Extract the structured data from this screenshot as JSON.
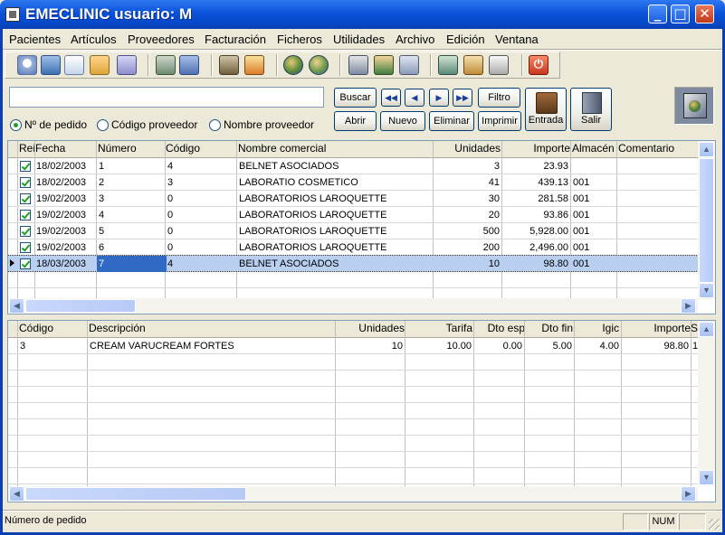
{
  "window": {
    "title": "EMECLINIC usuario: M"
  },
  "menu": [
    {
      "label": "Pacientes"
    },
    {
      "label": "Artículos"
    },
    {
      "label": "Proveedores"
    },
    {
      "label": "Facturación"
    },
    {
      "label": "Ficheros"
    },
    {
      "label": "Utilidades"
    },
    {
      "label": "Archivo"
    },
    {
      "label": "Edición"
    },
    {
      "label": "Ventana"
    }
  ],
  "toolbar": {
    "icons": [
      "calendar-icon",
      "patient-icon",
      "patient-card-icon",
      "patients-icon",
      "patient-group-icon",
      "article-icon",
      "article-card-icon",
      "books-icon",
      "house-icon",
      "globe-icon",
      "globe-list-icon",
      "computer-icon",
      "users-icon",
      "network-icon",
      "notebook-icon",
      "mail-user-icon",
      "printer-icon",
      "power-icon"
    ]
  },
  "search": {
    "value": "",
    "placeholder": ""
  },
  "buttons": {
    "buscar": "Buscar",
    "abrir": "Abrir",
    "nuevo": "Nuevo",
    "eliminar": "Eliminar",
    "imprimir": "Imprimir",
    "filtro": "Filtro",
    "entrada": "Entrada",
    "salir": "Salir"
  },
  "nav": {
    "first": "◀◀",
    "prev": "◀",
    "next": "▶",
    "last": "▶▶"
  },
  "search_mode": {
    "options": [
      "Nº de pedido",
      "Código proveedor",
      "Nombre proveedor"
    ],
    "selected": "Nº de pedido"
  },
  "orders": {
    "columns": [
      "Rei",
      "Fecha",
      "Número",
      "Código",
      "Nombre comercial",
      "Unidades",
      "Importe",
      "Almacén",
      "Comentario"
    ],
    "rows": [
      {
        "checked": true,
        "fecha": "18/02/2003",
        "numero": "1",
        "codigo": "4",
        "nombre": "BELNET ASOCIADOS",
        "unidades": "3",
        "importe": "23.93",
        "almacen": "",
        "comentario": ""
      },
      {
        "checked": true,
        "fecha": "18/02/2003",
        "numero": "2",
        "codigo": "3",
        "nombre": "LABORATIO COSMETICO",
        "unidades": "41",
        "importe": "439.13",
        "almacen": "001",
        "comentario": ""
      },
      {
        "checked": true,
        "fecha": "19/02/2003",
        "numero": "3",
        "codigo": "0",
        "nombre": "LABORATORIOS LAROQUETTE",
        "unidades": "30",
        "importe": "281.58",
        "almacen": "001",
        "comentario": ""
      },
      {
        "checked": true,
        "fecha": "19/02/2003",
        "numero": "4",
        "codigo": "0",
        "nombre": "LABORATORIOS LAROQUETTE",
        "unidades": "20",
        "importe": "93.86",
        "almacen": "001",
        "comentario": ""
      },
      {
        "checked": true,
        "fecha": "19/02/2003",
        "numero": "5",
        "codigo": "0",
        "nombre": "LABORATORIOS LAROQUETTE",
        "unidades": "500",
        "importe": "5,928.00",
        "almacen": "001",
        "comentario": ""
      },
      {
        "checked": true,
        "fecha": "19/02/2003",
        "numero": "6",
        "codigo": "0",
        "nombre": "LABORATORIOS LAROQUETTE",
        "unidades": "200",
        "importe": "2,496.00",
        "almacen": "001",
        "comentario": ""
      },
      {
        "checked": true,
        "fecha": "18/03/2003",
        "numero": "7",
        "codigo": "4",
        "nombre": "BELNET ASOCIADOS",
        "unidades": "10",
        "importe": "98.80",
        "almacen": "001",
        "comentario": "",
        "selected": true
      }
    ]
  },
  "lines": {
    "columns": [
      "Código",
      "Descripción",
      "Unidades",
      "Tarifa",
      "Dto esp",
      "Dto fin",
      "Igic",
      "ImporteS"
    ],
    "rows": [
      {
        "codigo": "3",
        "descripcion": "CREAM VARUCREAM FORTES",
        "unidades": "10",
        "tarifa": "10.00",
        "dto_esp": "0.00",
        "dto_fin": "5.00",
        "igic": "4.00",
        "importe": "98.80",
        "extra": "1"
      }
    ]
  },
  "status": {
    "message": "Número de pedido",
    "num": "NUM"
  },
  "colors": {
    "title_blue": "#0A52DA",
    "selected_row": "#B8CFF0",
    "selected_cell": "#316AC5",
    "check_green": "#21A121"
  }
}
